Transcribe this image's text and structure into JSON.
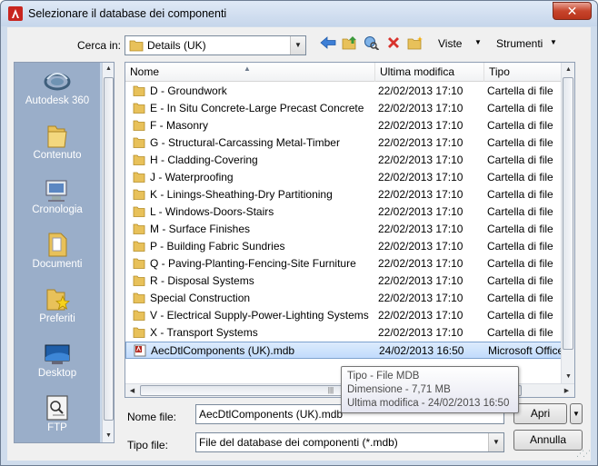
{
  "window": {
    "title": "Selezionare il database dei componenti",
    "close_glyph": "✕"
  },
  "toolbar": {
    "look_in_label": "Cerca in:",
    "look_in_value": "Details (UK)",
    "back_icon": "back-arrow-icon",
    "up_icon": "up-folder-icon",
    "search_icon": "search-web-icon",
    "delete_icon": "delete-icon",
    "new_folder_icon": "new-folder-icon",
    "views_label": "Viste",
    "tools_label": "Strumenti"
  },
  "places": [
    {
      "label": "Autodesk 360",
      "icon": "autodesk-360-icon"
    },
    {
      "label": "Contenuto",
      "icon": "content-folder-icon"
    },
    {
      "label": "Cronologia",
      "icon": "history-icon"
    },
    {
      "label": "Documenti",
      "icon": "documents-icon"
    },
    {
      "label": "Preferiti",
      "icon": "favorites-icon"
    },
    {
      "label": "Desktop",
      "icon": "desktop-icon"
    },
    {
      "label": "FTP",
      "icon": "ftp-icon"
    }
  ],
  "columns": {
    "name": "Nome",
    "modified": "Ultima modifica",
    "type": "Tipo"
  },
  "files": [
    {
      "name": "D - Groundwork",
      "date": "22/02/2013 17:10",
      "type": "Cartella di file"
    },
    {
      "name": "E - In Situ Concrete-Large Precast Concrete",
      "date": "22/02/2013 17:10",
      "type": "Cartella di file"
    },
    {
      "name": "F - Masonry",
      "date": "22/02/2013 17:10",
      "type": "Cartella di file"
    },
    {
      "name": "G - Structural-Carcassing Metal-Timber",
      "date": "22/02/2013 17:10",
      "type": "Cartella di file"
    },
    {
      "name": "H - Cladding-Covering",
      "date": "22/02/2013 17:10",
      "type": "Cartella di file"
    },
    {
      "name": "J - Waterproofing",
      "date": "22/02/2013 17:10",
      "type": "Cartella di file"
    },
    {
      "name": "K - Linings-Sheathing-Dry Partitioning",
      "date": "22/02/2013 17:10",
      "type": "Cartella di file"
    },
    {
      "name": "L - Windows-Doors-Stairs",
      "date": "22/02/2013 17:10",
      "type": "Cartella di file"
    },
    {
      "name": "M - Surface Finishes",
      "date": "22/02/2013 17:10",
      "type": "Cartella di file"
    },
    {
      "name": "P - Building Fabric Sundries",
      "date": "22/02/2013 17:10",
      "type": "Cartella di file"
    },
    {
      "name": "Q - Paving-Planting-Fencing-Site Furniture",
      "date": "22/02/2013 17:10",
      "type": "Cartella di file"
    },
    {
      "name": "R - Disposal Systems",
      "date": "22/02/2013 17:10",
      "type": "Cartella di file"
    },
    {
      "name": "Special Construction",
      "date": "22/02/2013 17:10",
      "type": "Cartella di file"
    },
    {
      "name": "V - Electrical Supply-Power-Lighting Systems",
      "date": "22/02/2013 17:10",
      "type": "Cartella di file"
    },
    {
      "name": "X - Transport Systems",
      "date": "22/02/2013 17:10",
      "type": "Cartella di file"
    },
    {
      "name": "AecDtlComponents (UK).mdb",
      "date": "24/02/2013 16:50",
      "type": "Microsoft Office A",
      "selected": true,
      "icon": "mdb-file-icon"
    }
  ],
  "tooltip": {
    "type": "Tipo - File MDB",
    "size": "Dimensione - 7,71 MB",
    "modified": "Ultima modifica - 24/02/2013 16:50"
  },
  "bottom": {
    "filename_label": "Nome file:",
    "filename_value": "AecDtlComponents (UK).mdb",
    "filetype_label": "Tipo file:",
    "filetype_value": "File del database dei componenti (*.mdb)",
    "open_label": "Apri",
    "cancel_label": "Annulla"
  },
  "colors": {
    "folder": "#e8c15a",
    "places_bg": "#9aaec9",
    "selection": "#c1dbfc"
  }
}
